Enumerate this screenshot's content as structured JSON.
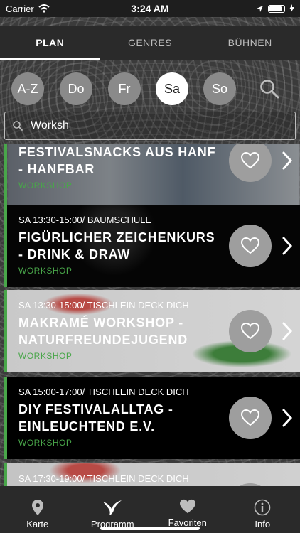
{
  "status": {
    "carrier": "Carrier",
    "time": "3:24 AM"
  },
  "tabs": [
    {
      "label": "PLAN",
      "active": true
    },
    {
      "label": "GENRES",
      "active": false
    },
    {
      "label": "BÜHNEN",
      "active": false
    }
  ],
  "days": [
    {
      "label": "A-Z",
      "active": false
    },
    {
      "label": "Do",
      "active": false
    },
    {
      "label": "Fr",
      "active": false
    },
    {
      "label": "Sa",
      "active": true
    },
    {
      "label": "So",
      "active": false
    }
  ],
  "search": {
    "value": "Worksh"
  },
  "events": [
    {
      "meta": "",
      "title_line1": "FESTIVALSNACKS AUS HANF",
      "title_line2": "- HANFBAR",
      "category": "WORKSHOP"
    },
    {
      "meta": "SA 13:30-15:00/ BAUMSCHULE",
      "title_line1": "FIGÜRLICHER ZEICHENKURS",
      "title_line2": "- DRINK & DRAW",
      "category": "WORKSHOP"
    },
    {
      "meta": "SA 13:30-15:00/ TISCHLEIN DECK DICH",
      "title_line1": "MAKRAMÉ WORKSHOP -",
      "title_line2": "NATURFREUNDEJUGEND",
      "category": "WORKSHOP"
    },
    {
      "meta": "SA 15:00-17:00/ TISCHLEIN DECK DICH",
      "title_line1": "DIY FESTIVALALLTAG -",
      "title_line2": "EINLEUCHTEND E.V.",
      "category": "WORKSHOP"
    },
    {
      "meta": "SA 17:30-19:00/ TISCHLEIN DECK DICH",
      "title_line1": "",
      "title_line2": "",
      "category": ""
    }
  ],
  "bottom_nav": [
    {
      "label": "Karte",
      "icon": "map-pin-icon"
    },
    {
      "label": "Programm",
      "icon": "bird-icon"
    },
    {
      "label": "Favoriten",
      "icon": "heart-icon"
    },
    {
      "label": "Info",
      "icon": "info-icon"
    }
  ],
  "colors": {
    "accent_green": "#49a64a",
    "tab_bar": "#2a2a2a",
    "day_inactive": "#8a8a8a"
  }
}
